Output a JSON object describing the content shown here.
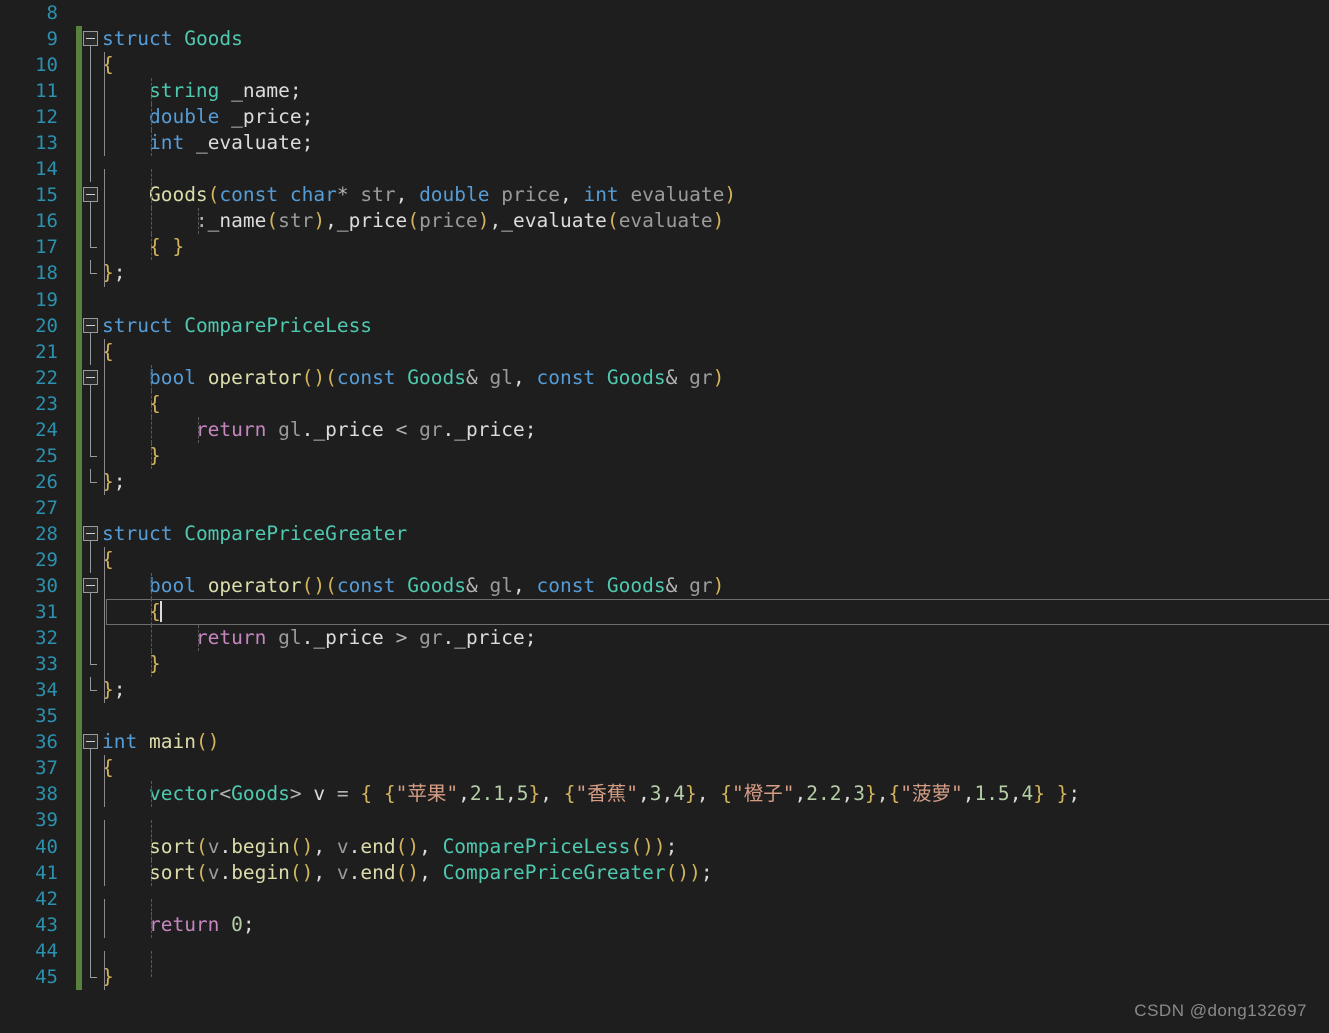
{
  "editor": {
    "theme": "visual-studio-dark",
    "background": "#1e1e1e",
    "line_number_color": "#2b91af",
    "change_bar_color": "#57813c",
    "current_line": 31,
    "first_visible_line": 8,
    "last_visible_line": 45
  },
  "watermark": {
    "text": "CSDN @dong132697"
  },
  "lines": [
    {
      "n": "8",
      "text": ""
    },
    {
      "n": "9",
      "text": "struct Goods"
    },
    {
      "n": "10",
      "text": "{"
    },
    {
      "n": "11",
      "text": "    string _name;"
    },
    {
      "n": "12",
      "text": "    double _price;"
    },
    {
      "n": "13",
      "text": "    int _evaluate;"
    },
    {
      "n": "14",
      "text": ""
    },
    {
      "n": "15",
      "text": "    Goods(const char* str, double price, int evaluate)"
    },
    {
      "n": "16",
      "text": "        :_name(str),_price(price),_evaluate(evaluate)"
    },
    {
      "n": "17",
      "text": "    { }"
    },
    {
      "n": "18",
      "text": "};"
    },
    {
      "n": "19",
      "text": ""
    },
    {
      "n": "20",
      "text": "struct ComparePriceLess"
    },
    {
      "n": "21",
      "text": "{"
    },
    {
      "n": "22",
      "text": "    bool operator()(const Goods& gl, const Goods& gr)"
    },
    {
      "n": "23",
      "text": "    {"
    },
    {
      "n": "24",
      "text": "        return gl._price < gr._price;"
    },
    {
      "n": "25",
      "text": "    }"
    },
    {
      "n": "26",
      "text": "};"
    },
    {
      "n": "27",
      "text": ""
    },
    {
      "n": "28",
      "text": "struct ComparePriceGreater"
    },
    {
      "n": "29",
      "text": "{"
    },
    {
      "n": "30",
      "text": "    bool operator()(const Goods& gl, const Goods& gr)"
    },
    {
      "n": "31",
      "text": "    {"
    },
    {
      "n": "32",
      "text": "        return gl._price > gr._price;"
    },
    {
      "n": "33",
      "text": "    }"
    },
    {
      "n": "34",
      "text": "};"
    },
    {
      "n": "35",
      "text": ""
    },
    {
      "n": "36",
      "text": "int main()"
    },
    {
      "n": "37",
      "text": "{"
    },
    {
      "n": "38",
      "text": "    vector<Goods> v = { {\"苹果\",2.1,5}, {\"香蕉\",3,4}, {\"橙子\",2.2,3},{\"菠萝\",1.5,4} };"
    },
    {
      "n": "39",
      "text": ""
    },
    {
      "n": "40",
      "text": "    sort(v.begin(), v.end(), ComparePriceLess());"
    },
    {
      "n": "41",
      "text": "    sort(v.begin(), v.end(), ComparePriceGreater());"
    },
    {
      "n": "42",
      "text": ""
    },
    {
      "n": "43",
      "text": "    return 0;"
    },
    {
      "n": "44",
      "text": ""
    },
    {
      "n": "45",
      "text": "}"
    }
  ],
  "tokens": {
    "ln8": [],
    "ln9": [
      [
        "kw",
        "struct"
      ],
      [
        "plain",
        " "
      ],
      [
        "type",
        "Goods"
      ]
    ],
    "ln10": [
      [
        "brace",
        "{"
      ]
    ],
    "ln11": [
      [
        "plain",
        "    "
      ],
      [
        "type",
        "string"
      ],
      [
        "plain",
        " "
      ],
      [
        "member",
        "_name"
      ],
      [
        "semi",
        ";"
      ]
    ],
    "ln12": [
      [
        "plain",
        "    "
      ],
      [
        "kw",
        "double"
      ],
      [
        "plain",
        " "
      ],
      [
        "member",
        "_price"
      ],
      [
        "semi",
        ";"
      ]
    ],
    "ln13": [
      [
        "plain",
        "    "
      ],
      [
        "kw",
        "int"
      ],
      [
        "plain",
        " "
      ],
      [
        "member",
        "_evaluate"
      ],
      [
        "semi",
        ";"
      ]
    ],
    "ln14": [],
    "ln15": [
      [
        "plain",
        "    "
      ],
      [
        "fn",
        "Goods"
      ],
      [
        "paren",
        "("
      ],
      [
        "kw",
        "const"
      ],
      [
        "plain",
        " "
      ],
      [
        "kw",
        "char"
      ],
      [
        "op",
        "*"
      ],
      [
        "plain",
        " "
      ],
      [
        "var",
        "str"
      ],
      [
        "punct",
        ", "
      ],
      [
        "kw",
        "double"
      ],
      [
        "plain",
        " "
      ],
      [
        "var",
        "price"
      ],
      [
        "punct",
        ", "
      ],
      [
        "kw",
        "int"
      ],
      [
        "plain",
        " "
      ],
      [
        "var",
        "evaluate"
      ],
      [
        "paren",
        ")"
      ]
    ],
    "ln16": [
      [
        "plain",
        "        "
      ],
      [
        "op",
        ":"
      ],
      [
        "member",
        "_name"
      ],
      [
        "paren",
        "("
      ],
      [
        "var",
        "str"
      ],
      [
        "paren",
        ")"
      ],
      [
        "punct",
        ","
      ],
      [
        "member",
        "_price"
      ],
      [
        "paren",
        "("
      ],
      [
        "var",
        "price"
      ],
      [
        "paren",
        ")"
      ],
      [
        "punct",
        ","
      ],
      [
        "member",
        "_evaluate"
      ],
      [
        "paren",
        "("
      ],
      [
        "var",
        "evaluate"
      ],
      [
        "paren",
        ")"
      ]
    ],
    "ln17": [
      [
        "plain",
        "    "
      ],
      [
        "brace",
        "{ }"
      ]
    ],
    "ln18": [
      [
        "brace",
        "}"
      ],
      [
        "semi",
        ";"
      ]
    ],
    "ln19": [],
    "ln20": [
      [
        "kw",
        "struct"
      ],
      [
        "plain",
        " "
      ],
      [
        "type",
        "ComparePriceLess"
      ]
    ],
    "ln21": [
      [
        "brace",
        "{"
      ]
    ],
    "ln22": [
      [
        "plain",
        "    "
      ],
      [
        "kw",
        "bool"
      ],
      [
        "plain",
        " "
      ],
      [
        "fn",
        "operator"
      ],
      [
        "paren",
        "()("
      ],
      [
        "kw",
        "const"
      ],
      [
        "plain",
        " "
      ],
      [
        "type",
        "Goods"
      ],
      [
        "op",
        "&"
      ],
      [
        "plain",
        " "
      ],
      [
        "var",
        "gl"
      ],
      [
        "punct",
        ", "
      ],
      [
        "kw",
        "const"
      ],
      [
        "plain",
        " "
      ],
      [
        "type",
        "Goods"
      ],
      [
        "op",
        "&"
      ],
      [
        "plain",
        " "
      ],
      [
        "var",
        "gr"
      ],
      [
        "paren",
        ")"
      ]
    ],
    "ln23": [
      [
        "plain",
        "    "
      ],
      [
        "brace",
        "{"
      ]
    ],
    "ln24": [
      [
        "plain",
        "        "
      ],
      [
        "ret",
        "return"
      ],
      [
        "plain",
        " "
      ],
      [
        "var",
        "gl"
      ],
      [
        "punct",
        "."
      ],
      [
        "member",
        "_price"
      ],
      [
        "plain",
        " "
      ],
      [
        "op",
        "<"
      ],
      [
        "plain",
        " "
      ],
      [
        "var",
        "gr"
      ],
      [
        "punct",
        "."
      ],
      [
        "member",
        "_price"
      ],
      [
        "semi",
        ";"
      ]
    ],
    "ln25": [
      [
        "plain",
        "    "
      ],
      [
        "brace",
        "}"
      ]
    ],
    "ln26": [
      [
        "brace",
        "}"
      ],
      [
        "semi",
        ";"
      ]
    ],
    "ln27": [],
    "ln28": [
      [
        "kw",
        "struct"
      ],
      [
        "plain",
        " "
      ],
      [
        "type",
        "ComparePriceGreater"
      ]
    ],
    "ln29": [
      [
        "brace",
        "{"
      ]
    ],
    "ln30": [
      [
        "plain",
        "    "
      ],
      [
        "kw",
        "bool"
      ],
      [
        "plain",
        " "
      ],
      [
        "fn",
        "operator"
      ],
      [
        "paren",
        "()("
      ],
      [
        "kw",
        "const"
      ],
      [
        "plain",
        " "
      ],
      [
        "type",
        "Goods"
      ],
      [
        "op",
        "&"
      ],
      [
        "plain",
        " "
      ],
      [
        "var",
        "gl"
      ],
      [
        "punct",
        ", "
      ],
      [
        "kw",
        "const"
      ],
      [
        "plain",
        " "
      ],
      [
        "type",
        "Goods"
      ],
      [
        "op",
        "&"
      ],
      [
        "plain",
        " "
      ],
      [
        "var",
        "gr"
      ],
      [
        "paren",
        ")"
      ]
    ],
    "ln31": [
      [
        "plain",
        "    "
      ],
      [
        "brace",
        "{"
      ],
      [
        "caret",
        ""
      ]
    ],
    "ln32": [
      [
        "plain",
        "        "
      ],
      [
        "ret",
        "return"
      ],
      [
        "plain",
        " "
      ],
      [
        "var",
        "gl"
      ],
      [
        "punct",
        "."
      ],
      [
        "member",
        "_price"
      ],
      [
        "plain",
        " "
      ],
      [
        "op",
        ">"
      ],
      [
        "plain",
        " "
      ],
      [
        "var",
        "gr"
      ],
      [
        "punct",
        "."
      ],
      [
        "member",
        "_price"
      ],
      [
        "semi",
        ";"
      ]
    ],
    "ln33": [
      [
        "plain",
        "    "
      ],
      [
        "brace",
        "}"
      ]
    ],
    "ln34": [
      [
        "brace",
        "}"
      ],
      [
        "semi",
        ";"
      ]
    ],
    "ln35": [],
    "ln36": [
      [
        "kw",
        "int"
      ],
      [
        "plain",
        " "
      ],
      [
        "fn",
        "main"
      ],
      [
        "paren",
        "()"
      ]
    ],
    "ln37": [
      [
        "brace",
        "{"
      ]
    ],
    "ln38": [
      [
        "plain",
        "    "
      ],
      [
        "type",
        "vector"
      ],
      [
        "op",
        "<"
      ],
      [
        "type",
        "Goods"
      ],
      [
        "op",
        "> "
      ],
      [
        "plain",
        "v "
      ],
      [
        "op",
        "="
      ],
      [
        "plain",
        " "
      ],
      [
        "brace",
        "{ {"
      ],
      [
        "str",
        "\"苹果\""
      ],
      [
        "punct",
        ","
      ],
      [
        "num",
        "2.1"
      ],
      [
        "punct",
        ","
      ],
      [
        "num",
        "5"
      ],
      [
        "brace",
        "}"
      ],
      [
        "punct",
        ", "
      ],
      [
        "brace",
        "{"
      ],
      [
        "str",
        "\"香蕉\""
      ],
      [
        "punct",
        ","
      ],
      [
        "num",
        "3"
      ],
      [
        "punct",
        ","
      ],
      [
        "num",
        "4"
      ],
      [
        "brace",
        "}"
      ],
      [
        "punct",
        ", "
      ],
      [
        "brace",
        "{"
      ],
      [
        "str",
        "\"橙子\""
      ],
      [
        "punct",
        ","
      ],
      [
        "num",
        "2.2"
      ],
      [
        "punct",
        ","
      ],
      [
        "num",
        "3"
      ],
      [
        "brace",
        "}"
      ],
      [
        "punct",
        ","
      ],
      [
        "brace",
        "{"
      ],
      [
        "str",
        "\"菠萝\""
      ],
      [
        "punct",
        ","
      ],
      [
        "num",
        "1.5"
      ],
      [
        "punct",
        ","
      ],
      [
        "num",
        "4"
      ],
      [
        "brace",
        "} }"
      ],
      [
        "semi",
        ";"
      ]
    ],
    "ln39": [],
    "ln40": [
      [
        "plain",
        "    "
      ],
      [
        "fn",
        "sort"
      ],
      [
        "paren",
        "("
      ],
      [
        "var",
        "v"
      ],
      [
        "punct",
        "."
      ],
      [
        "fn",
        "begin"
      ],
      [
        "paren",
        "()"
      ],
      [
        "punct",
        ", "
      ],
      [
        "var",
        "v"
      ],
      [
        "punct",
        "."
      ],
      [
        "fn",
        "end"
      ],
      [
        "paren",
        "()"
      ],
      [
        "punct",
        ", "
      ],
      [
        "type",
        "ComparePriceLess"
      ],
      [
        "paren",
        "())"
      ],
      [
        "semi",
        ";"
      ]
    ],
    "ln41": [
      [
        "plain",
        "    "
      ],
      [
        "fn",
        "sort"
      ],
      [
        "paren",
        "("
      ],
      [
        "var",
        "v"
      ],
      [
        "punct",
        "."
      ],
      [
        "fn",
        "begin"
      ],
      [
        "paren",
        "()"
      ],
      [
        "punct",
        ", "
      ],
      [
        "var",
        "v"
      ],
      [
        "punct",
        "."
      ],
      [
        "fn",
        "end"
      ],
      [
        "paren",
        "()"
      ],
      [
        "punct",
        ", "
      ],
      [
        "type",
        "ComparePriceGreater"
      ],
      [
        "paren",
        "())"
      ],
      [
        "semi",
        ";"
      ]
    ],
    "ln42": [],
    "ln43": [
      [
        "plain",
        "    "
      ],
      [
        "ret",
        "return"
      ],
      [
        "plain",
        " "
      ],
      [
        "num",
        "0"
      ],
      [
        "semi",
        ";"
      ]
    ],
    "ln44": [],
    "ln45": [
      [
        "brace",
        "}"
      ]
    ]
  },
  "gutter": {
    "fold_markers": {
      "9": "box",
      "15": "box",
      "20": "box",
      "22": "box",
      "28": "box",
      "30": "box",
      "36": "box"
    },
    "changed_lines": [
      "9",
      "10",
      "11",
      "12",
      "13",
      "14",
      "15",
      "16",
      "17",
      "18",
      "19",
      "20",
      "21",
      "22",
      "23",
      "24",
      "25",
      "26",
      "27",
      "28",
      "29",
      "30",
      "31",
      "32",
      "33",
      "34",
      "35",
      "36",
      "37",
      "38",
      "39",
      "40",
      "41",
      "42",
      "43",
      "44",
      "45"
    ]
  },
  "indent_guides": {
    "9": [],
    "10": [
      [
        "solid",
        0
      ]
    ],
    "11": [
      [
        "solid",
        0
      ],
      [
        "dash",
        1
      ]
    ],
    "12": [
      [
        "solid",
        0
      ],
      [
        "dash",
        1
      ]
    ],
    "13": [
      [
        "solid",
        0
      ],
      [
        "dash",
        1
      ]
    ],
    "14": [
      [
        "solid",
        0
      ],
      [
        "dash",
        1
      ]
    ],
    "15": [
      [
        "solid",
        0
      ],
      [
        "dash",
        1
      ]
    ],
    "16": [
      [
        "solid",
        0
      ],
      [
        "dash",
        1
      ],
      [
        "dash",
        2
      ]
    ],
    "17": [
      [
        "solid",
        0
      ],
      [
        "dash",
        1
      ]
    ],
    "18": [
      [
        "solid",
        0
      ]
    ],
    "20": [],
    "21": [
      [
        "solid",
        0
      ]
    ],
    "22": [
      [
        "solid",
        0
      ],
      [
        "dash",
        1
      ]
    ],
    "23": [
      [
        "solid",
        0
      ],
      [
        "dash",
        1
      ]
    ],
    "24": [
      [
        "solid",
        0
      ],
      [
        "dash",
        1
      ],
      [
        "dash",
        2
      ]
    ],
    "25": [
      [
        "solid",
        0
      ],
      [
        "dash",
        1
      ]
    ],
    "26": [
      [
        "solid",
        0
      ]
    ],
    "28": [],
    "29": [
      [
        "solid",
        0
      ]
    ],
    "30": [
      [
        "solid",
        0
      ],
      [
        "dash",
        1
      ]
    ],
    "31": [
      [
        "solid",
        0
      ],
      [
        "dash",
        1
      ]
    ],
    "32": [
      [
        "solid",
        0
      ],
      [
        "dash",
        1
      ],
      [
        "dash",
        2
      ]
    ],
    "33": [
      [
        "solid",
        0
      ],
      [
        "dash",
        1
      ]
    ],
    "34": [
      [
        "solid",
        0
      ]
    ],
    "36": [],
    "37": [
      [
        "solid",
        0
      ]
    ],
    "38": [
      [
        "solid",
        0
      ],
      [
        "dash",
        1
      ]
    ],
    "39": [
      [
        "solid",
        0
      ],
      [
        "dash",
        1
      ]
    ],
    "40": [
      [
        "solid",
        0
      ],
      [
        "dash",
        1
      ]
    ],
    "41": [
      [
        "solid",
        0
      ],
      [
        "dash",
        1
      ]
    ],
    "42": [
      [
        "solid",
        0
      ],
      [
        "dash",
        1
      ]
    ],
    "43": [
      [
        "solid",
        0
      ],
      [
        "dash",
        1
      ]
    ],
    "44": [
      [
        "solid",
        0
      ],
      [
        "dash",
        1
      ]
    ],
    "45": [
      [
        "solid",
        0
      ]
    ]
  }
}
